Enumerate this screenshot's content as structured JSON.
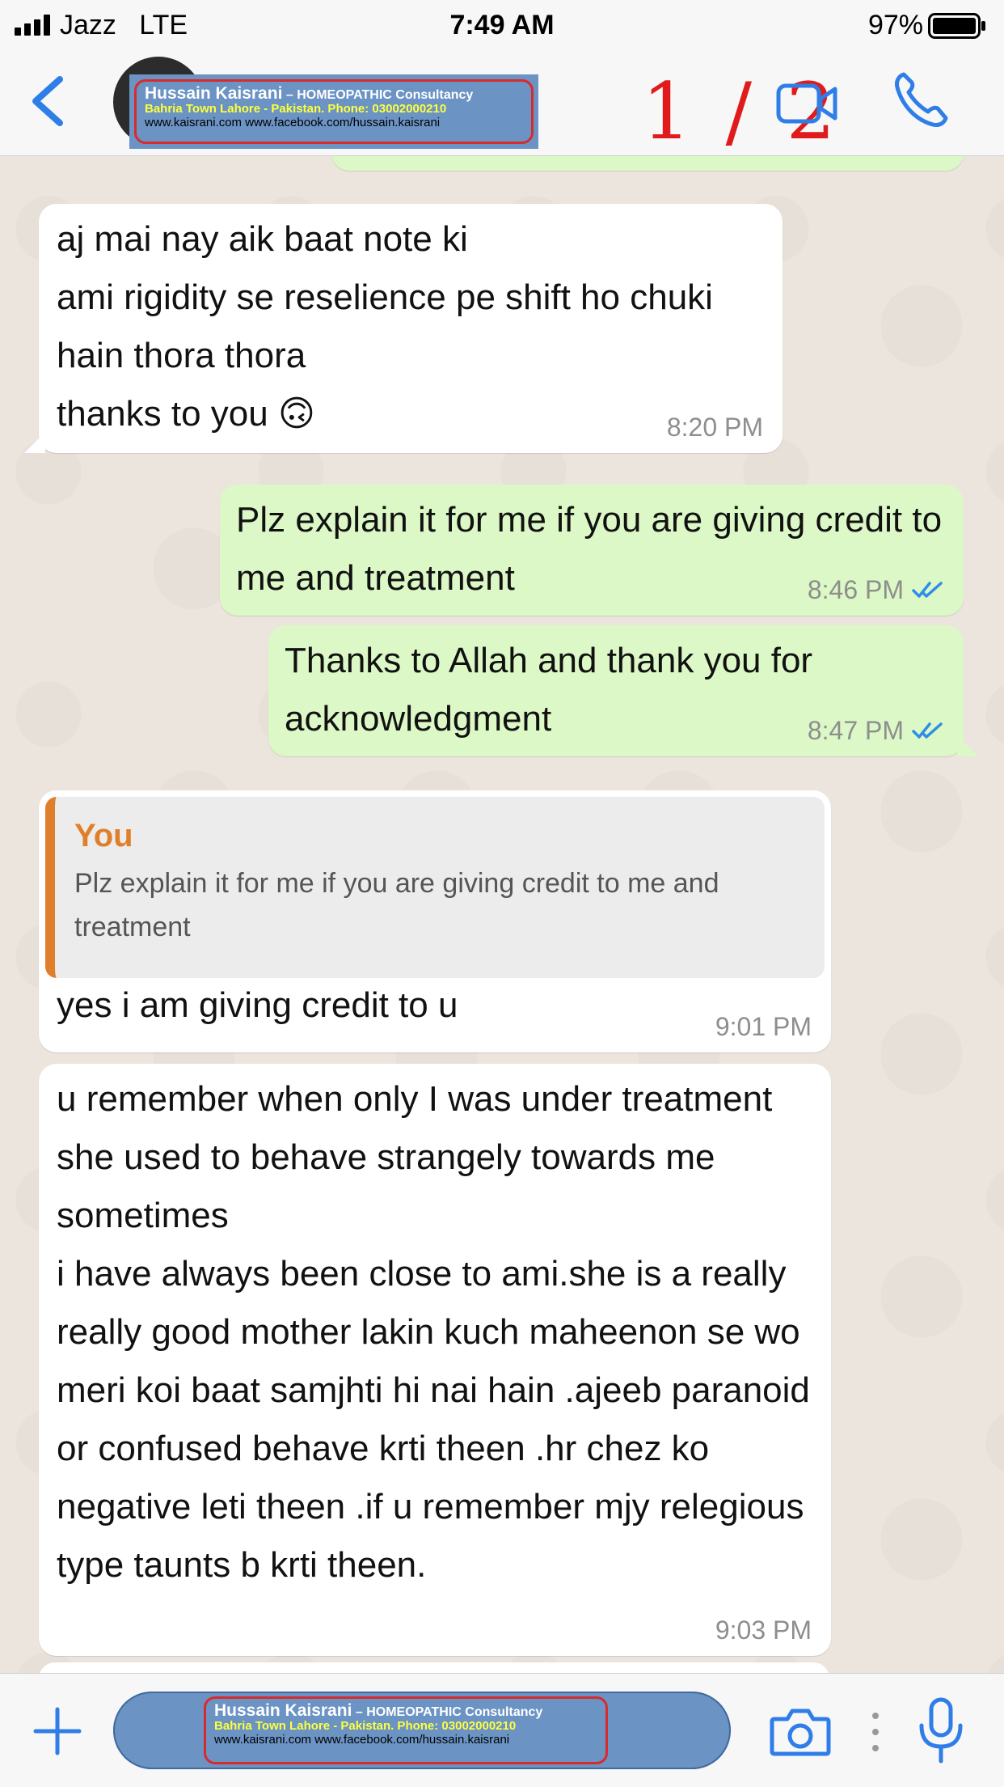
{
  "status_bar": {
    "carrier": "Jazz",
    "network": "LTE",
    "time": "7:49 AM",
    "battery_percent": "97%"
  },
  "header": {
    "banner_line1_name": "Hussain Kaisrani",
    "banner_line1_suffix": " – HOMEOPATHIC Consultancy",
    "banner_line2": "Bahria Town Lahore - Pakistan.  Phone: 03002000210",
    "banner_line3": "www.kaisrani.com     www.facebook.com/hussain.kaisrani",
    "page_indicator": "1 / 2"
  },
  "colors": {
    "accent": "#2f7ee8",
    "incoming_bubble": "#ffffff",
    "outgoing_bubble": "#dcf8c6",
    "quote_bar": "#e07f2b",
    "banner_bg": "#6b93c4",
    "banner_border": "#d82b2b",
    "page_indicator": "#e01b1b"
  },
  "messages": [
    {
      "direction": "in",
      "text": "aj mai nay aik baat note ki\nami rigidity se reselience pe shift ho chuki hain thora thora\nthanks to you 🙃",
      "time": "8:20 PM"
    },
    {
      "direction": "out",
      "text": "Plz explain it for me if you are giving credit to me and treatment",
      "time": "8:46 PM",
      "status_icon": "double-check-read"
    },
    {
      "direction": "out",
      "text": "Thanks to Allah and thank you for acknowledgment",
      "time": "8:47 PM",
      "status_icon": "double-check-read"
    },
    {
      "direction": "in",
      "quote_author": "You",
      "quote_text": "Plz explain it for me if you are giving credit to me and treatment",
      "text": "yes i am giving credit to u",
      "time": "9:01 PM"
    },
    {
      "direction": "in",
      "text": "u remember when only I was under treatment she used to behave strangely towards me sometimes\ni have always been close to ami.she is a really really good mother lakin kuch maheenon se wo meri koi baat samjhti hi nai hain .ajeeb paranoid or confused behave krti theen .hr chez ko negative leti theen .if u remember mjy relegious type taunts b krti theen.",
      "time": "9:03 PM"
    }
  ],
  "footer": {
    "icons": [
      "plus-icon",
      "camera-icon",
      "more-dots-icon",
      "microphone-icon"
    ]
  }
}
